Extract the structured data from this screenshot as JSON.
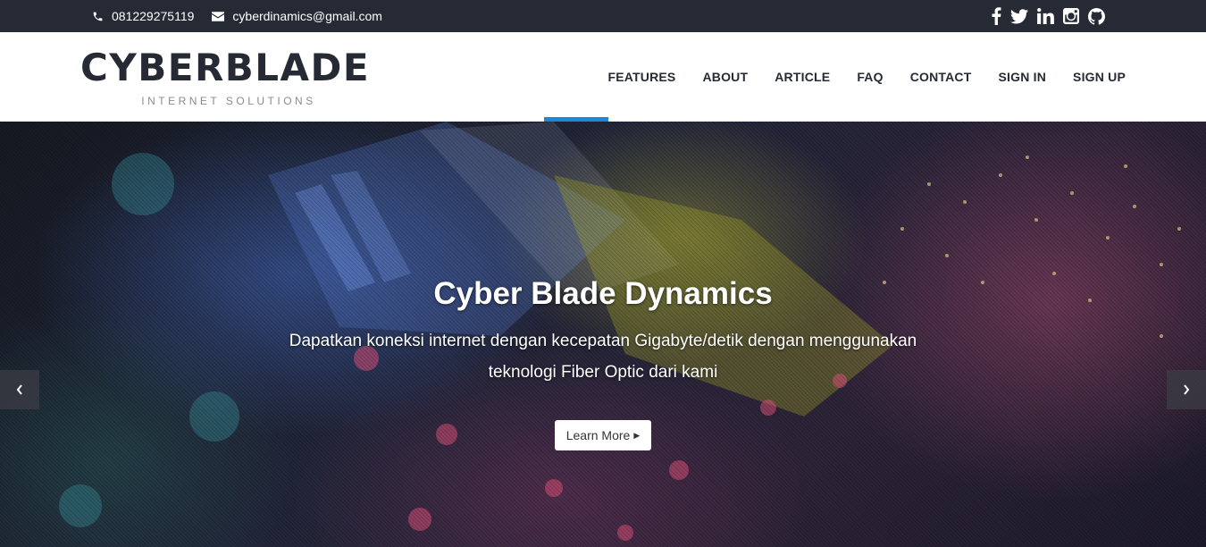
{
  "topbar": {
    "phone": "081229275119",
    "email": "cyberdinamics@gmail.com",
    "social": [
      "facebook-icon",
      "twitter-icon",
      "linkedin-icon",
      "instagram-icon",
      "github-icon"
    ]
  },
  "brand": {
    "name": "CYBERBLADE",
    "tagline": "INTERNET SOLUTIONS"
  },
  "nav": {
    "items": [
      "FEATURES",
      "ABOUT",
      "ARTICLE",
      "FAQ",
      "CONTACT",
      "SIGN IN",
      "SIGN UP"
    ],
    "indicator_color": "#1e88d4"
  },
  "hero": {
    "title": "Cyber Blade Dynamics",
    "subtitle": "Dapatkan koneksi internet dengan kecepatan Gigabyte/detik dengan menggunakan teknologi Fiber Optic dari kami",
    "button_label": "Learn More",
    "prev_icon": "chevron-left-icon",
    "next_icon": "chevron-right-icon"
  },
  "colors": {
    "topbar_bg": "#262a35",
    "header_bg": "#ffffff",
    "nav_text": "#262a35",
    "accent": "#1e88d4"
  }
}
